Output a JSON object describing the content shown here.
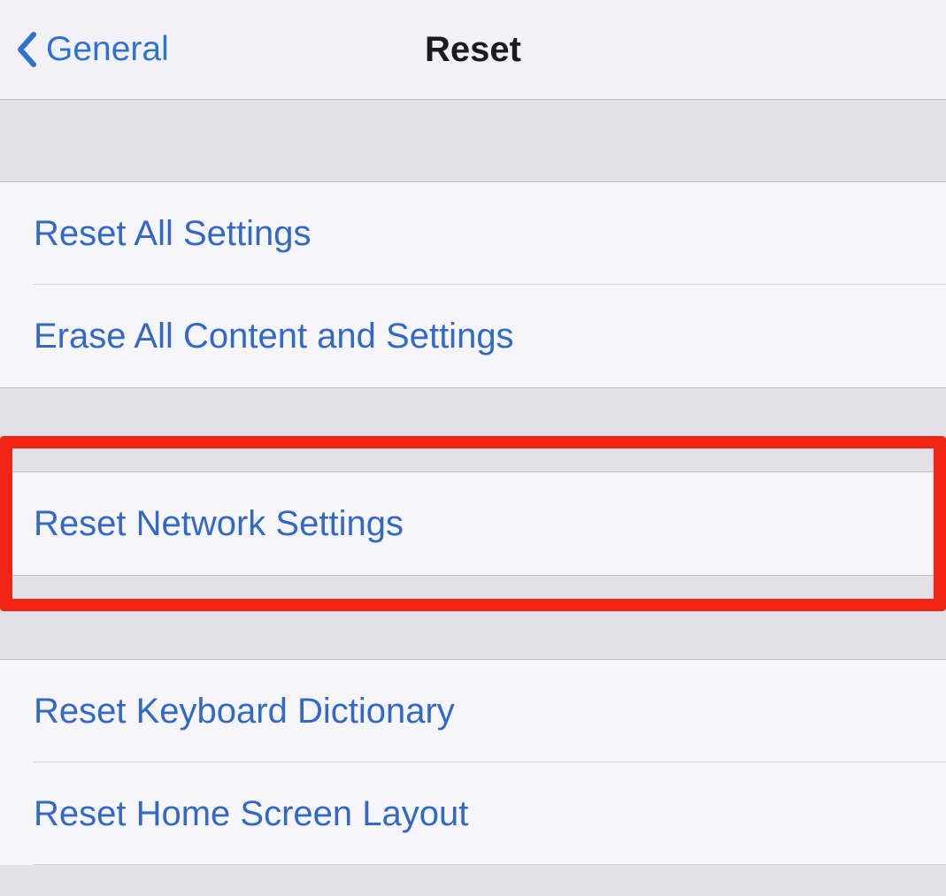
{
  "header": {
    "back_label": "General",
    "title": "Reset"
  },
  "sections": [
    {
      "items": [
        {
          "label": "Reset All Settings",
          "name": "reset-all-settings"
        },
        {
          "label": "Erase All Content and Settings",
          "name": "erase-all-content-settings"
        }
      ]
    },
    {
      "highlighted": true,
      "items": [
        {
          "label": "Reset Network Settings",
          "name": "reset-network-settings"
        }
      ]
    },
    {
      "items": [
        {
          "label": "Reset Keyboard Dictionary",
          "name": "reset-keyboard-dictionary"
        },
        {
          "label": "Reset Home Screen Layout",
          "name": "reset-home-screen-layout"
        }
      ]
    }
  ]
}
